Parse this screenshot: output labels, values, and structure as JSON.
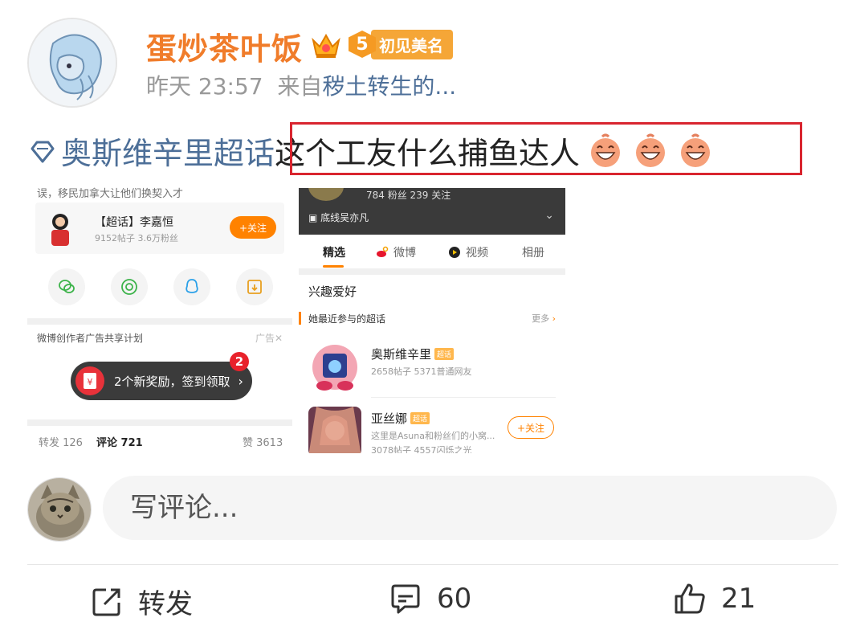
{
  "post": {
    "author": "蛋炒茶叶饭",
    "level": "5",
    "level_label": "初见美名",
    "time": "昨天 23:57",
    "source_prefix": "来自",
    "source_name": "秽土转生的...",
    "topic": "奥斯维辛里超话",
    "body": "这个工友什么捕鱼达人"
  },
  "image_left": {
    "cut_text": "误，移民加拿大让他们换契入才",
    "supertopic_title": "【超话】李嘉恒",
    "supertopic_sub": "9152帖子 3.6万粉丝",
    "follow_label": "+关注",
    "share_icons": [
      "wechat-icon",
      "moments-icon",
      "qq-icon",
      "save-image-icon"
    ],
    "ad_label": "微博创作者广告共享计划",
    "ad_close": "广告✕",
    "reward_text": "2个新奖励，签到领取",
    "reward_badge": "2",
    "repost_stat": "转发 126",
    "comment_stat": "评论 721",
    "like_stat": "赞 3613"
  },
  "image_right": {
    "profile_stats": "784 粉丝     239 关注",
    "profile_location": "底线吴亦凡",
    "tabs": [
      {
        "label": "精选",
        "icon": ""
      },
      {
        "label": "微博",
        "icon": "weibo-icon"
      },
      {
        "label": "视频",
        "icon": "video-icon"
      },
      {
        "label": "相册",
        "icon": ""
      }
    ],
    "interest_title": "兴趣爱好",
    "section_title": "她最近参与的超话",
    "section_more": "更多",
    "supertopics": [
      {
        "name": "奥斯维辛里",
        "tag": "超话",
        "sub": "2658帖子 5371普通网友",
        "sub2": "",
        "follow": ""
      },
      {
        "name": "亚丝娜",
        "tag": "超话",
        "sub": "这里是Asuna和粉丝们的小窝...",
        "sub2": "3078帖子 4557闪烁之光",
        "follow": "+关注"
      }
    ]
  },
  "comment": {
    "placeholder": "写评论..."
  },
  "actions": {
    "repost_label": "转发",
    "comment_count": "60",
    "like_count": "21"
  },
  "colors": {
    "author": "#f07c2a",
    "link": "#4d6f98",
    "highlight": "#d9252f",
    "accent": "#ff8200"
  }
}
